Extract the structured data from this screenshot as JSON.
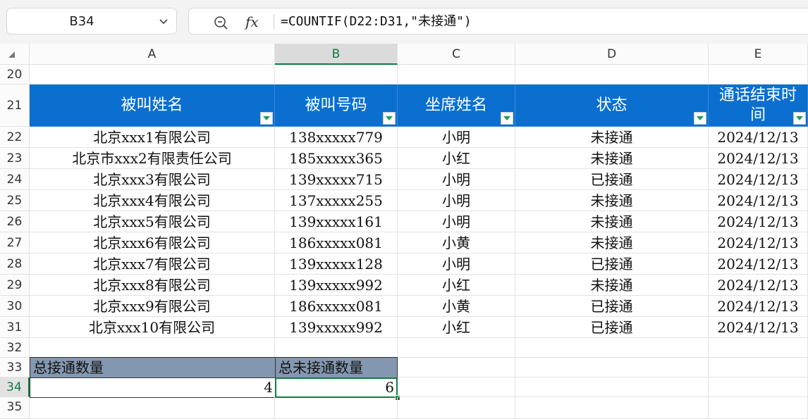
{
  "name_box": "B34",
  "formula": "=COUNTIF(D22:D31,\"未接通\")",
  "columns": [
    "A",
    "B",
    "C",
    "D",
    "E"
  ],
  "rows": [
    "20",
    "21",
    "22",
    "23",
    "24",
    "25",
    "26",
    "27",
    "28",
    "29",
    "30",
    "31",
    "32",
    "33",
    "34",
    "35"
  ],
  "table_header": {
    "a": "被叫姓名",
    "b": "被叫号码",
    "c": "坐席姓名",
    "d": "状态",
    "e_line1": "通话结束时",
    "e_line2": "间"
  },
  "records": [
    {
      "a": "北京xxx1有限公司",
      "b": "138xxxxx779",
      "c": "小明",
      "d": "未接通",
      "e": "2024/12/13"
    },
    {
      "a": "北京市xxx2有限责任公司",
      "b": "185xxxxx365",
      "c": "小红",
      "d": "未接通",
      "e": "2024/12/13"
    },
    {
      "a": "北京xxx3有限公司",
      "b": "139xxxxx715",
      "c": "小明",
      "d": "已接通",
      "e": "2024/12/13"
    },
    {
      "a": "北京xxx4有限公司",
      "b": "137xxxxx255",
      "c": "小明",
      "d": "未接通",
      "e": "2024/12/13"
    },
    {
      "a": "北京xxx5有限公司",
      "b": "139xxxxx161",
      "c": "小明",
      "d": "未接通",
      "e": "2024/12/13"
    },
    {
      "a": "北京xxx6有限公司",
      "b": "186xxxxx081",
      "c": "小黄",
      "d": "未接通",
      "e": "2024/12/13"
    },
    {
      "a": "北京xxx7有限公司",
      "b": "139xxxxx128",
      "c": "小明",
      "d": "已接通",
      "e": "2024/12/13"
    },
    {
      "a": "北京xxx8有限公司",
      "b": "139xxxxx992",
      "c": "小红",
      "d": "未接通",
      "e": "2024/12/13"
    },
    {
      "a": "北京xxx9有限公司",
      "b": "186xxxxx081",
      "c": "小黄",
      "d": "已接通",
      "e": "2024/12/13"
    },
    {
      "a": "北京xxx10有限公司",
      "b": "139xxxxx992",
      "c": "小红",
      "d": "已接通",
      "e": "2024/12/13"
    }
  ],
  "summary": {
    "connected_label": "总接通数量",
    "not_connected_label": "总未接通数量",
    "connected_value": "4",
    "not_connected_value": "6"
  },
  "colors": {
    "header_fill": "#0b6fd0",
    "summary_fill": "#8497b0",
    "selection": "#107c41"
  },
  "icons": [
    "chevron-down-icon",
    "zoom-out-icon",
    "fx-icon",
    "filter-dropdown-icon"
  ]
}
